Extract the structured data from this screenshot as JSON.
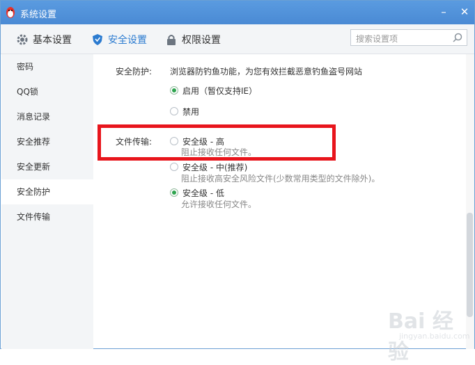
{
  "window": {
    "title": "系统设置",
    "minimize_label": "–",
    "close_label": "✕"
  },
  "tabs": [
    {
      "label": "基本设置",
      "icon": "gear-icon"
    },
    {
      "label": "安全设置",
      "icon": "shield-icon"
    },
    {
      "label": "权限设置",
      "icon": "lock-icon"
    }
  ],
  "search": {
    "placeholder": "搜索设置项"
  },
  "sidebar": {
    "items": [
      {
        "label": "密码"
      },
      {
        "label": "QQ锁"
      },
      {
        "label": "消息记录"
      },
      {
        "label": "安全推荐"
      },
      {
        "label": "安全更新"
      },
      {
        "label": "安全防护"
      },
      {
        "label": "文件传输"
      }
    ],
    "active": "安全防护"
  },
  "security_protection": {
    "label": "安全防护:",
    "description": "浏览器防钓鱼功能，为您有效拦截恶意钓鱼盗号网站",
    "options": [
      {
        "label": "启用（暂仅支持IE）",
        "checked": true
      },
      {
        "label": "禁用",
        "checked": false
      }
    ]
  },
  "file_transfer": {
    "label": "文件传输:",
    "options": [
      {
        "label": "安全级 - 高",
        "sub": "阻止接收任何文件。",
        "checked": false
      },
      {
        "label": "安全级 - 中(推荐)",
        "sub": "阻止接收高安全风险文件(少数常用类型的文件除外)。",
        "checked": false
      },
      {
        "label": "安全级 - 低",
        "sub": "允许接收任何文件。",
        "checked": true
      }
    ]
  },
  "watermark": {
    "main": "Bai 经验",
    "sub": "jingyan.baidu.com"
  },
  "colors": {
    "titlebar": "#4a8ad4",
    "accent": "#2b7bd0",
    "highlight": "#e8151c",
    "radio_checked": "#2ea44f"
  }
}
